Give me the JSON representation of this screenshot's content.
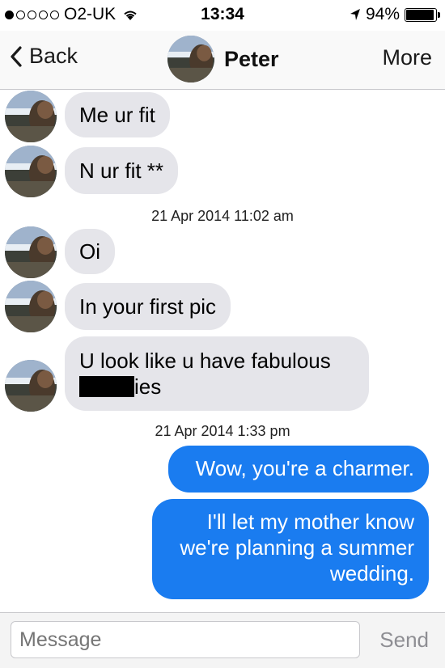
{
  "status_bar": {
    "carrier": "O2-UK",
    "time": "13:34",
    "battery": "94%",
    "signal_dots_filled": 1,
    "signal_dots_total": 5,
    "battery_level": 0.94
  },
  "nav": {
    "back_label": "Back",
    "contact_name": "Peter",
    "more_label": "More"
  },
  "messages": [
    {
      "text": "Me ur fit"
    },
    {
      "text": "N ur fit **"
    },
    {
      "text": "Oi"
    },
    {
      "text": "In your first pic"
    },
    {
      "line1": "U look like u have fabulous",
      "line2_suffix": "ies"
    },
    {
      "text": "Wow, you're a charmer."
    },
    {
      "line1": "I'll let my mother know",
      "line2": "we're planning a summer",
      "line3": "wedding."
    }
  ],
  "timestamps": [
    "21 Apr 2014 11:02 am",
    "21 Apr 2014 1:33 pm"
  ],
  "input": {
    "placeholder": "Message",
    "send_label": "Send"
  },
  "colors": {
    "outgoing_bubble": "#1a7cf0",
    "incoming_bubble": "#e5e5ea",
    "send_disabled": "#8e8e93"
  }
}
